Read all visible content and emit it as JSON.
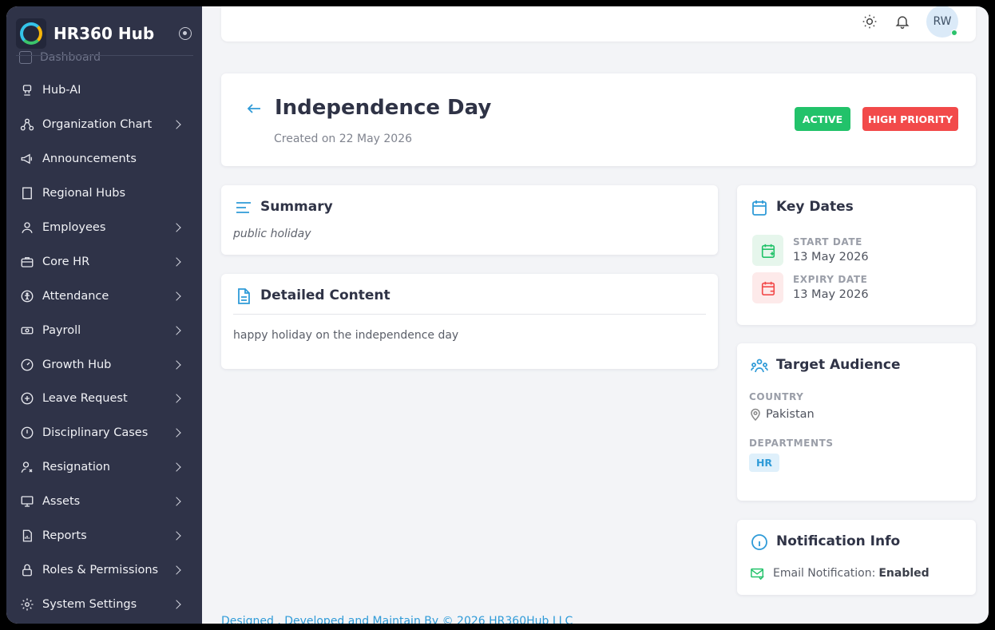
{
  "app": {
    "name": "HR360 Hub"
  },
  "sidebar": {
    "faded_item": "Dashboard",
    "items": [
      {
        "label": "Hub-AI",
        "icon": "robot-icon",
        "has_children": false
      },
      {
        "label": "Organization Chart",
        "icon": "org-chart-icon",
        "has_children": true
      },
      {
        "label": "Announcements",
        "icon": "megaphone-icon",
        "has_children": false
      },
      {
        "label": "Regional Hubs",
        "icon": "building-icon",
        "has_children": false
      },
      {
        "label": "Employees",
        "icon": "user-icon",
        "has_children": true
      },
      {
        "label": "Core HR",
        "icon": "briefcase-icon",
        "has_children": true
      },
      {
        "label": "Attendance",
        "icon": "person-circle-icon",
        "has_children": true
      },
      {
        "label": "Payroll",
        "icon": "money-icon",
        "has_children": true
      },
      {
        "label": "Growth Hub",
        "icon": "gauge-icon",
        "has_children": true
      },
      {
        "label": "Leave Request",
        "icon": "plus-circle-icon",
        "has_children": true
      },
      {
        "label": "Disciplinary Cases",
        "icon": "alert-circle-icon",
        "has_children": true
      },
      {
        "label": "Resignation",
        "icon": "user-x-icon",
        "has_children": true
      },
      {
        "label": "Assets",
        "icon": "monitor-icon",
        "has_children": true
      },
      {
        "label": "Reports",
        "icon": "report-icon",
        "has_children": true
      },
      {
        "label": "Roles & Permissions",
        "icon": "lock-icon",
        "has_children": true
      },
      {
        "label": "System Settings",
        "icon": "gear-icon",
        "has_children": true
      }
    ]
  },
  "topbar": {
    "avatar_initials": "RW",
    "avatar_status_color": "#2cc26c"
  },
  "announcement": {
    "title": "Independence Day",
    "created": "Created on 22 May 2026",
    "status_badge": "ACTIVE",
    "priority_badge": "HIGH PRIORITY"
  },
  "summary": {
    "heading": "Summary",
    "text": "public holiday"
  },
  "detail": {
    "heading": "Detailed Content",
    "text": "happy holiday on the independence day"
  },
  "key_dates": {
    "heading": "Key Dates",
    "start_label": "START DATE",
    "start_value": "13 May 2026",
    "expiry_label": "EXPIRY DATE",
    "expiry_value": "13 May 2026"
  },
  "audience": {
    "heading": "Target Audience",
    "country_label": "COUNTRY",
    "country_value": "Pakistan",
    "departments_label": "DEPARTMENTS",
    "department": "HR"
  },
  "notification": {
    "heading": "Notification Info",
    "email_label": "Email Notification:",
    "email_value": "Enabled"
  },
  "footer": {
    "text": "Designed , Developed and Maintain By © 2026 HR360Hub LLC"
  },
  "colors": {
    "sidebar_bg": "#2f3348",
    "accent": "#2f9bd8",
    "active_green": "#22c26a",
    "priority_red": "#f24a4a"
  }
}
